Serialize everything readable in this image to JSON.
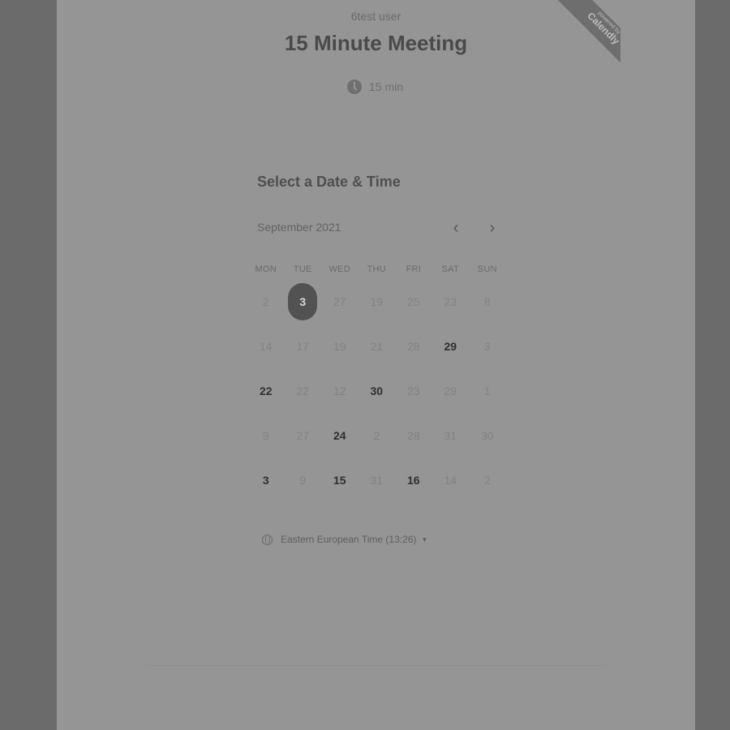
{
  "header": {
    "user_name": "6test user",
    "event_title": "15 Minute Meeting",
    "duration": "15 min",
    "ribbon_small": "powered by",
    "ribbon_brand": "Calendly"
  },
  "picker": {
    "section_title": "Select a Date & Time",
    "month_label": "September 2021",
    "weekdays": [
      "MON",
      "TUE",
      "WED",
      "THU",
      "FRI",
      "SAT",
      "SUN"
    ],
    "weeks": [
      [
        {
          "d": "2",
          "s": "off"
        },
        {
          "d": "3",
          "s": "selected"
        },
        {
          "d": "27",
          "s": "off"
        },
        {
          "d": "19",
          "s": "off"
        },
        {
          "d": "25",
          "s": "off"
        },
        {
          "d": "23",
          "s": "off"
        },
        {
          "d": "8",
          "s": "off"
        }
      ],
      [
        {
          "d": "14",
          "s": "off"
        },
        {
          "d": "17",
          "s": "off"
        },
        {
          "d": "19",
          "s": "off"
        },
        {
          "d": "21",
          "s": "off"
        },
        {
          "d": "28",
          "s": "off"
        },
        {
          "d": "29",
          "s": "available"
        },
        {
          "d": "3",
          "s": "off"
        }
      ],
      [
        {
          "d": "22",
          "s": "available"
        },
        {
          "d": "22",
          "s": "off"
        },
        {
          "d": "12",
          "s": "off"
        },
        {
          "d": "30",
          "s": "available"
        },
        {
          "d": "23",
          "s": "off"
        },
        {
          "d": "29",
          "s": "off"
        },
        {
          "d": "1",
          "s": "off"
        }
      ],
      [
        {
          "d": "9",
          "s": "off"
        },
        {
          "d": "27",
          "s": "off"
        },
        {
          "d": "24",
          "s": "available"
        },
        {
          "d": "2",
          "s": "off"
        },
        {
          "d": "28",
          "s": "off"
        },
        {
          "d": "31",
          "s": "off"
        },
        {
          "d": "30",
          "s": "off"
        }
      ],
      [
        {
          "d": "3",
          "s": "available"
        },
        {
          "d": "9",
          "s": "off"
        },
        {
          "d": "15",
          "s": "available"
        },
        {
          "d": "31",
          "s": "off"
        },
        {
          "d": "16",
          "s": "available"
        },
        {
          "d": "14",
          "s": "off"
        },
        {
          "d": "2",
          "s": "off"
        }
      ]
    ],
    "prev_icon": "chevron-left-icon",
    "next_icon": "chevron-right-icon"
  },
  "timezone": {
    "label": "Eastern European Time (13:26)",
    "icon": "globe-icon"
  }
}
